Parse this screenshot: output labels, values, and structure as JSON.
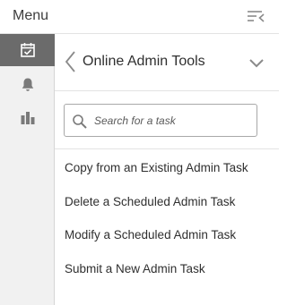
{
  "header": {
    "title": "Menu",
    "collapse_icon": "collapse-menu-icon"
  },
  "rail": {
    "items": [
      {
        "name": "tasks",
        "icon": "calendar-check-icon",
        "active": true
      },
      {
        "name": "notifications",
        "icon": "bell-icon",
        "active": false
      },
      {
        "name": "reports",
        "icon": "bar-chart-icon",
        "active": false
      }
    ]
  },
  "panel": {
    "title": "Online Admin Tools",
    "back_icon": "chevron-left-icon",
    "expand_icon": "chevron-down-icon"
  },
  "search": {
    "placeholder": "Search for a task",
    "value": "",
    "icon": "search-icon"
  },
  "tasks": [
    "Copy from an Existing Admin Task",
    "Delete a Scheduled Admin Task",
    "Modify a Scheduled Admin Task",
    "Submit a New Admin Task"
  ],
  "colors": {
    "rail_active": "#6b6b6b",
    "rail_bg": "#f1f1f1",
    "icon_gray": "#7a7a7a"
  }
}
